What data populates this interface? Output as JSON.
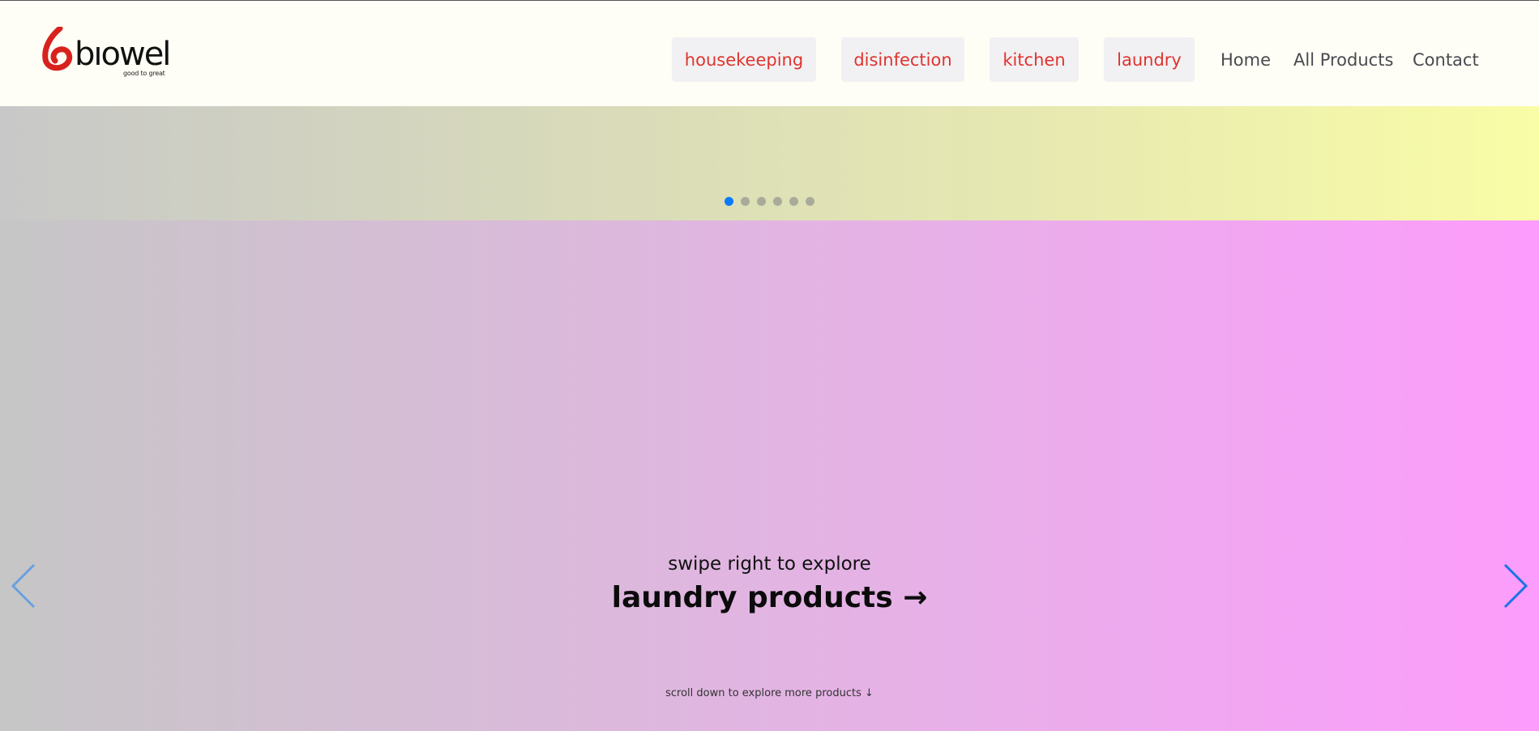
{
  "header": {
    "logo": {
      "wordmark": "bıowel",
      "tagline": "good to great",
      "icon": "biowel-logo-icon",
      "brand_color": "#e0342e"
    },
    "categories": [
      {
        "label": "housekeeping"
      },
      {
        "label": "disinfection"
      },
      {
        "label": "kitchen"
      },
      {
        "label": "laundry"
      }
    ],
    "links": [
      {
        "label": "Home"
      },
      {
        "label": "All Products"
      },
      {
        "label": "Contact"
      }
    ]
  },
  "carousel": {
    "indicator_count": 6,
    "active_index": 0,
    "active_color": "#0a7bfd",
    "prev_icon": "chevron-left-icon",
    "next_icon": "chevron-right-icon"
  },
  "slide": {
    "subtitle": "swipe right to explore",
    "title": "laundry products →",
    "scroll_hint": "scroll down to explore more products ↓"
  }
}
